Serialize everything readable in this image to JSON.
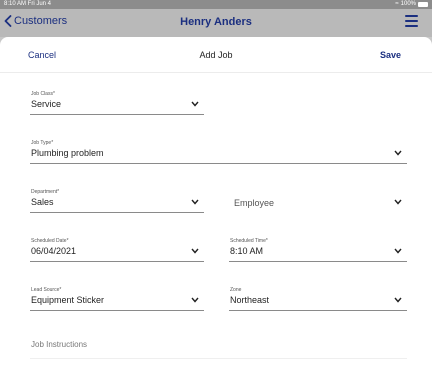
{
  "status_bar": {
    "time_date": "8:10 AM  Fri Jun 4",
    "battery": "100%"
  },
  "nav": {
    "back_label": "Customers",
    "title": "Henry Anders"
  },
  "sheet": {
    "cancel_label": "Cancel",
    "title": "Add Job",
    "save_label": "Save"
  },
  "form": {
    "job_class": {
      "label": "Job Class*",
      "value": "Service"
    },
    "job_type": {
      "label": "Job Type*",
      "value": "Plumbing problem"
    },
    "department": {
      "label": "Department*",
      "value": "Sales"
    },
    "employee": {
      "placeholder": "Employee"
    },
    "scheduled_date": {
      "label": "Scheduled Date*",
      "value": "06/04/2021"
    },
    "scheduled_time": {
      "label": "Scheduled Time*",
      "value": "8:10 AM"
    },
    "lead_source": {
      "label": "Lead Source*",
      "value": "Equipment Sticker"
    },
    "zone": {
      "label": "Zone",
      "value": "Northeast"
    },
    "job_instructions": {
      "placeholder": "Job Instructions"
    }
  },
  "colors": {
    "accent": "#1b2f80",
    "backdrop": "#c8c8c8",
    "sheet": "#ffffff"
  }
}
